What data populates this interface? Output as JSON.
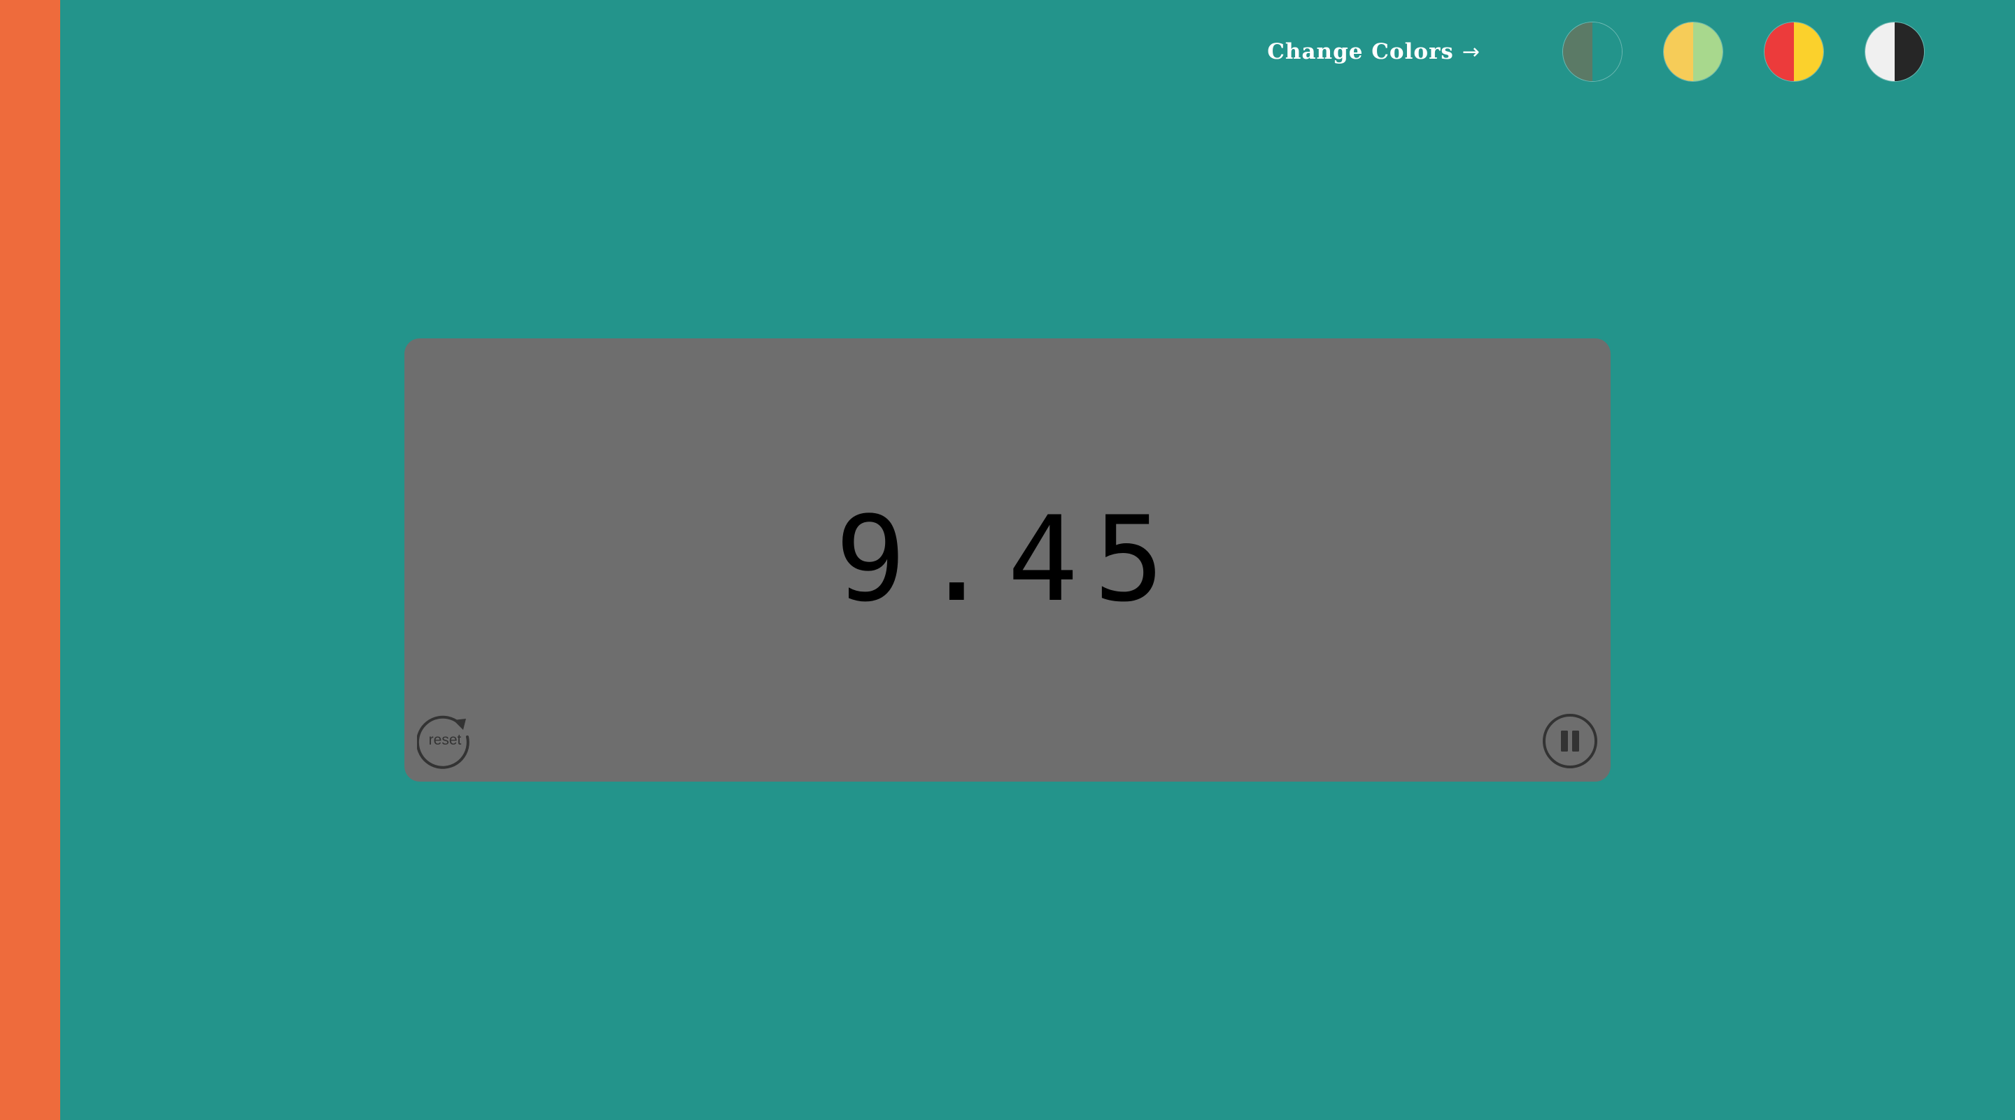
{
  "timer": {
    "value": "9.45",
    "reset_label": "reset",
    "reset_icon": "reset-icon",
    "pause_icon": "pause-icon"
  },
  "header": {
    "change_colors_label": "Change Colors",
    "arrow_glyph": "→"
  },
  "color_themes": [
    {
      "name": "teal-green",
      "left": "#5b7a66",
      "right": "#23948b"
    },
    {
      "name": "yellow-green",
      "left": "#f6cc58",
      "right": "#a8d88d"
    },
    {
      "name": "red-yellow",
      "left": "#ec3b3b",
      "right": "#fbd12c"
    },
    {
      "name": "white-black",
      "left": "#f0f0f0",
      "right": "#262626"
    }
  ],
  "colors": {
    "background": "#23948b",
    "progress": "#ee6b3c",
    "card": "#6e6e6e"
  }
}
